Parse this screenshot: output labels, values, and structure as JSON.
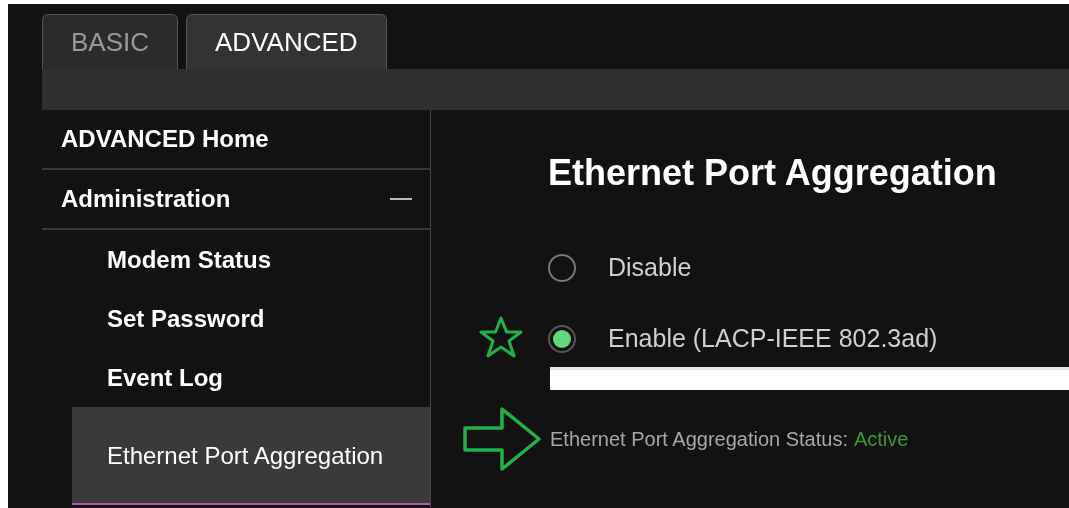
{
  "tabs": [
    {
      "label": "BASIC",
      "selected": false
    },
    {
      "label": "ADVANCED",
      "selected": true
    }
  ],
  "sidebar": {
    "items": [
      {
        "label": "ADVANCED Home",
        "selected": false
      },
      {
        "label": "Administration",
        "selected": false,
        "expanded": true,
        "children": [
          {
            "label": "Modem Status",
            "selected": false
          },
          {
            "label": "Set Password",
            "selected": false
          },
          {
            "label": "Event Log",
            "selected": false
          },
          {
            "label": "Ethernet Port Aggregation",
            "selected": true
          }
        ]
      }
    ]
  },
  "content": {
    "title": "Ethernet Port Aggregation",
    "options": [
      {
        "label": "Disable",
        "selected": false
      },
      {
        "label": "Enable (LACP-IEEE 802.3ad)",
        "selected": true
      }
    ],
    "status": {
      "label": "Ethernet Port Aggregation Status:",
      "value": "Active"
    }
  }
}
